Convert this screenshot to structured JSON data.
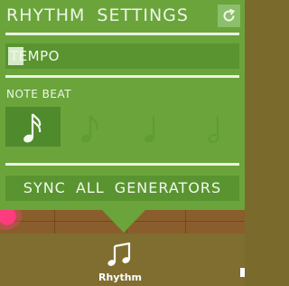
{
  "settings_panel": {
    "title": "RHYTHM SETTINGS",
    "refresh_icon": "refresh-icon",
    "tempo_label": "TEMPO",
    "note_beat_label": "NOTE BEAT",
    "note_beat_options": [
      {
        "icon": "sixteenth-note-icon",
        "selected": true
      },
      {
        "icon": "eighth-note-icon",
        "selected": false
      },
      {
        "icon": "quarter-note-icon",
        "selected": false
      },
      {
        "icon": "half-note-icon",
        "selected": false
      }
    ],
    "sync_button_label": "SYNC ALL GENERATORS"
  },
  "tab_bar": {
    "active_tab": {
      "label": "Rhythm",
      "icon": "music-note-icon"
    }
  },
  "colors": {
    "panel": "#6aa43b",
    "field": "#5a9431",
    "selected_beat": "#4f8a2d",
    "text": "#f2f8ec",
    "background": "#7b6b2d",
    "accent_pink": "#ff3b7f"
  }
}
